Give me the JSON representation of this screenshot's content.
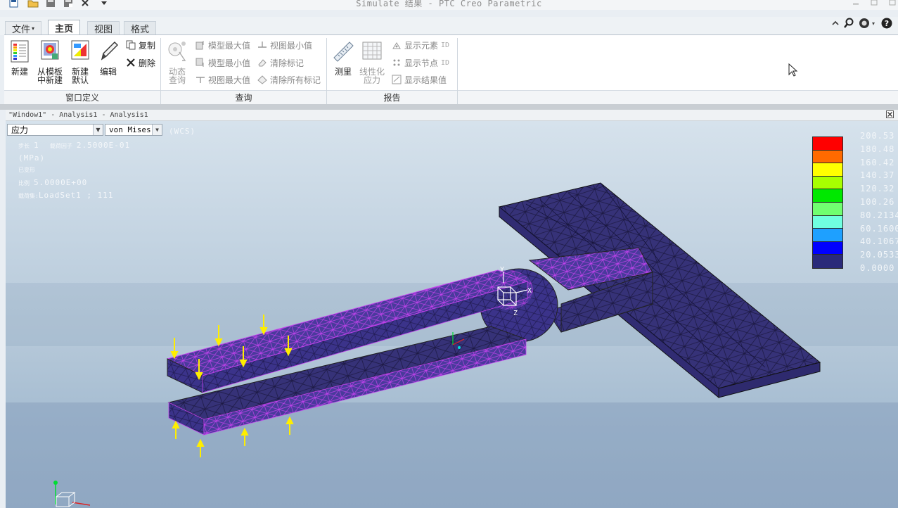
{
  "app_title": "Simulate 结果 - PTC Creo Parametric",
  "ribbon_tabs": {
    "file": "文件",
    "home": "主页",
    "view": "视图",
    "format": "格式"
  },
  "groups": {
    "window_definition": {
      "label": "窗口定义",
      "new": "新建",
      "from_template_line1": "从模板",
      "from_template_line2": "中新建",
      "new_default_line1": "新建",
      "new_default_line2": "默认",
      "edit": "编辑",
      "copy": "复制",
      "delete": "删除"
    },
    "query": {
      "label": "查询",
      "dynamic_query_line1": "动态",
      "dynamic_query_line2": "查询",
      "model_max": "模型最大值",
      "model_min": "模型最小值",
      "view_max": "视图最大值",
      "view_min": "视图最小值",
      "clear_tags": "清除标记",
      "clear_all_tags": "清除所有标记"
    },
    "report": {
      "label": "报告",
      "measure": "测里",
      "linearize_line1": "线性化",
      "linearize_line2": "应力",
      "show_element_id": "显示元素",
      "show_node_id": "显示节点",
      "id_suffix": "ID",
      "show_result_value": "显示结果值"
    }
  },
  "viewport": {
    "title": "\"Window1\" - Analysis1 - Analysis1",
    "quantity_select": "应力",
    "component_select": "von Mises",
    "csys_label": "(WCS)",
    "info": {
      "line1_label": "步长",
      "line1_value": "1",
      "line1_label2": "载荷因子",
      "line1_value2": "2.5000E-01",
      "units": "(MPa)",
      "deformed": "已变形",
      "scale_label": "比例",
      "scale_value": "5.0000E+00",
      "loadset_label": "载荷集:",
      "loadset_value": "LoadSet1 ;   111"
    },
    "axis_labels": {
      "x": "X",
      "y": "Y",
      "z": "Z"
    }
  },
  "legend": {
    "values": [
      "200.53",
      "180.48",
      "160.42",
      "140.37",
      "120.32",
      "100.26",
      "80.2134",
      "60.1600",
      "40.1067",
      "20.0533",
      "0.0000"
    ],
    "colors": [
      "#ff0000",
      "#ff6a00",
      "#ffff00",
      "#a8ff00",
      "#00e800",
      "#70ff70",
      "#70ffe0",
      "#1ea0ff",
      "#0000ff",
      "#2a2a7a"
    ]
  },
  "colors": {
    "mesh_fill": "#3a3680",
    "mesh_lines_highlight": "#c040e8",
    "load_arrow": "#ffff00"
  }
}
